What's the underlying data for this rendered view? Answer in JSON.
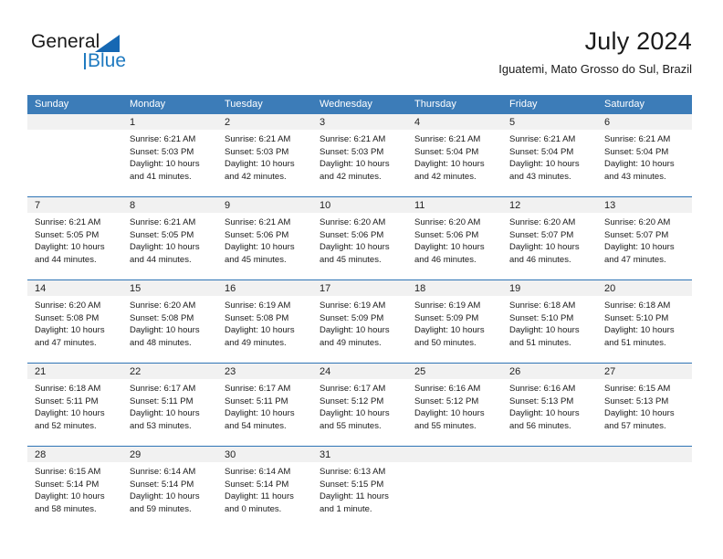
{
  "brand": {
    "word_one": "General",
    "word_two": "Blue",
    "triangle_icon": "brand-triangle-icon",
    "accent_color": "#1f7ac0"
  },
  "header": {
    "title": "July 2024",
    "location": "Iguatemi, Mato Grosso do Sul, Brazil"
  },
  "theme": {
    "header_row_bg": "#3c7cb8",
    "row_separator": "#2e74b5",
    "daynum_band_bg": "#f1f1f1",
    "text": "#1a1a1a"
  },
  "weekdays": [
    "Sunday",
    "Monday",
    "Tuesday",
    "Wednesday",
    "Thursday",
    "Friday",
    "Saturday"
  ],
  "weeks": [
    [
      {
        "day": "",
        "blank": true,
        "sunrise": "",
        "sunset": "",
        "daylight_line1": "",
        "daylight_line2": ""
      },
      {
        "day": "1",
        "sunrise": "Sunrise: 6:21 AM",
        "sunset": "Sunset: 5:03 PM",
        "daylight_line1": "Daylight: 10 hours",
        "daylight_line2": "and 41 minutes."
      },
      {
        "day": "2",
        "sunrise": "Sunrise: 6:21 AM",
        "sunset": "Sunset: 5:03 PM",
        "daylight_line1": "Daylight: 10 hours",
        "daylight_line2": "and 42 minutes."
      },
      {
        "day": "3",
        "sunrise": "Sunrise: 6:21 AM",
        "sunset": "Sunset: 5:03 PM",
        "daylight_line1": "Daylight: 10 hours",
        "daylight_line2": "and 42 minutes."
      },
      {
        "day": "4",
        "sunrise": "Sunrise: 6:21 AM",
        "sunset": "Sunset: 5:04 PM",
        "daylight_line1": "Daylight: 10 hours",
        "daylight_line2": "and 42 minutes."
      },
      {
        "day": "5",
        "sunrise": "Sunrise: 6:21 AM",
        "sunset": "Sunset: 5:04 PM",
        "daylight_line1": "Daylight: 10 hours",
        "daylight_line2": "and 43 minutes."
      },
      {
        "day": "6",
        "sunrise": "Sunrise: 6:21 AM",
        "sunset": "Sunset: 5:04 PM",
        "daylight_line1": "Daylight: 10 hours",
        "daylight_line2": "and 43 minutes."
      }
    ],
    [
      {
        "day": "7",
        "sunrise": "Sunrise: 6:21 AM",
        "sunset": "Sunset: 5:05 PM",
        "daylight_line1": "Daylight: 10 hours",
        "daylight_line2": "and 44 minutes."
      },
      {
        "day": "8",
        "sunrise": "Sunrise: 6:21 AM",
        "sunset": "Sunset: 5:05 PM",
        "daylight_line1": "Daylight: 10 hours",
        "daylight_line2": "and 44 minutes."
      },
      {
        "day": "9",
        "sunrise": "Sunrise: 6:21 AM",
        "sunset": "Sunset: 5:06 PM",
        "daylight_line1": "Daylight: 10 hours",
        "daylight_line2": "and 45 minutes."
      },
      {
        "day": "10",
        "sunrise": "Sunrise: 6:20 AM",
        "sunset": "Sunset: 5:06 PM",
        "daylight_line1": "Daylight: 10 hours",
        "daylight_line2": "and 45 minutes."
      },
      {
        "day": "11",
        "sunrise": "Sunrise: 6:20 AM",
        "sunset": "Sunset: 5:06 PM",
        "daylight_line1": "Daylight: 10 hours",
        "daylight_line2": "and 46 minutes."
      },
      {
        "day": "12",
        "sunrise": "Sunrise: 6:20 AM",
        "sunset": "Sunset: 5:07 PM",
        "daylight_line1": "Daylight: 10 hours",
        "daylight_line2": "and 46 minutes."
      },
      {
        "day": "13",
        "sunrise": "Sunrise: 6:20 AM",
        "sunset": "Sunset: 5:07 PM",
        "daylight_line1": "Daylight: 10 hours",
        "daylight_line2": "and 47 minutes."
      }
    ],
    [
      {
        "day": "14",
        "sunrise": "Sunrise: 6:20 AM",
        "sunset": "Sunset: 5:08 PM",
        "daylight_line1": "Daylight: 10 hours",
        "daylight_line2": "and 47 minutes."
      },
      {
        "day": "15",
        "sunrise": "Sunrise: 6:20 AM",
        "sunset": "Sunset: 5:08 PM",
        "daylight_line1": "Daylight: 10 hours",
        "daylight_line2": "and 48 minutes."
      },
      {
        "day": "16",
        "sunrise": "Sunrise: 6:19 AM",
        "sunset": "Sunset: 5:08 PM",
        "daylight_line1": "Daylight: 10 hours",
        "daylight_line2": "and 49 minutes."
      },
      {
        "day": "17",
        "sunrise": "Sunrise: 6:19 AM",
        "sunset": "Sunset: 5:09 PM",
        "daylight_line1": "Daylight: 10 hours",
        "daylight_line2": "and 49 minutes."
      },
      {
        "day": "18",
        "sunrise": "Sunrise: 6:19 AM",
        "sunset": "Sunset: 5:09 PM",
        "daylight_line1": "Daylight: 10 hours",
        "daylight_line2": "and 50 minutes."
      },
      {
        "day": "19",
        "sunrise": "Sunrise: 6:18 AM",
        "sunset": "Sunset: 5:10 PM",
        "daylight_line1": "Daylight: 10 hours",
        "daylight_line2": "and 51 minutes."
      },
      {
        "day": "20",
        "sunrise": "Sunrise: 6:18 AM",
        "sunset": "Sunset: 5:10 PM",
        "daylight_line1": "Daylight: 10 hours",
        "daylight_line2": "and 51 minutes."
      }
    ],
    [
      {
        "day": "21",
        "sunrise": "Sunrise: 6:18 AM",
        "sunset": "Sunset: 5:11 PM",
        "daylight_line1": "Daylight: 10 hours",
        "daylight_line2": "and 52 minutes."
      },
      {
        "day": "22",
        "sunrise": "Sunrise: 6:17 AM",
        "sunset": "Sunset: 5:11 PM",
        "daylight_line1": "Daylight: 10 hours",
        "daylight_line2": "and 53 minutes."
      },
      {
        "day": "23",
        "sunrise": "Sunrise: 6:17 AM",
        "sunset": "Sunset: 5:11 PM",
        "daylight_line1": "Daylight: 10 hours",
        "daylight_line2": "and 54 minutes."
      },
      {
        "day": "24",
        "sunrise": "Sunrise: 6:17 AM",
        "sunset": "Sunset: 5:12 PM",
        "daylight_line1": "Daylight: 10 hours",
        "daylight_line2": "and 55 minutes."
      },
      {
        "day": "25",
        "sunrise": "Sunrise: 6:16 AM",
        "sunset": "Sunset: 5:12 PM",
        "daylight_line1": "Daylight: 10 hours",
        "daylight_line2": "and 55 minutes."
      },
      {
        "day": "26",
        "sunrise": "Sunrise: 6:16 AM",
        "sunset": "Sunset: 5:13 PM",
        "daylight_line1": "Daylight: 10 hours",
        "daylight_line2": "and 56 minutes."
      },
      {
        "day": "27",
        "sunrise": "Sunrise: 6:15 AM",
        "sunset": "Sunset: 5:13 PM",
        "daylight_line1": "Daylight: 10 hours",
        "daylight_line2": "and 57 minutes."
      }
    ],
    [
      {
        "day": "28",
        "sunrise": "Sunrise: 6:15 AM",
        "sunset": "Sunset: 5:14 PM",
        "daylight_line1": "Daylight: 10 hours",
        "daylight_line2": "and 58 minutes."
      },
      {
        "day": "29",
        "sunrise": "Sunrise: 6:14 AM",
        "sunset": "Sunset: 5:14 PM",
        "daylight_line1": "Daylight: 10 hours",
        "daylight_line2": "and 59 minutes."
      },
      {
        "day": "30",
        "sunrise": "Sunrise: 6:14 AM",
        "sunset": "Sunset: 5:14 PM",
        "daylight_line1": "Daylight: 11 hours",
        "daylight_line2": "and 0 minutes."
      },
      {
        "day": "31",
        "sunrise": "Sunrise: 6:13 AM",
        "sunset": "Sunset: 5:15 PM",
        "daylight_line1": "Daylight: 11 hours",
        "daylight_line2": "and 1 minute."
      },
      {
        "day": "",
        "blank": true,
        "sunrise": "",
        "sunset": "",
        "daylight_line1": "",
        "daylight_line2": ""
      },
      {
        "day": "",
        "blank": true,
        "sunrise": "",
        "sunset": "",
        "daylight_line1": "",
        "daylight_line2": ""
      },
      {
        "day": "",
        "blank": true,
        "sunrise": "",
        "sunset": "",
        "daylight_line1": "",
        "daylight_line2": ""
      }
    ]
  ]
}
